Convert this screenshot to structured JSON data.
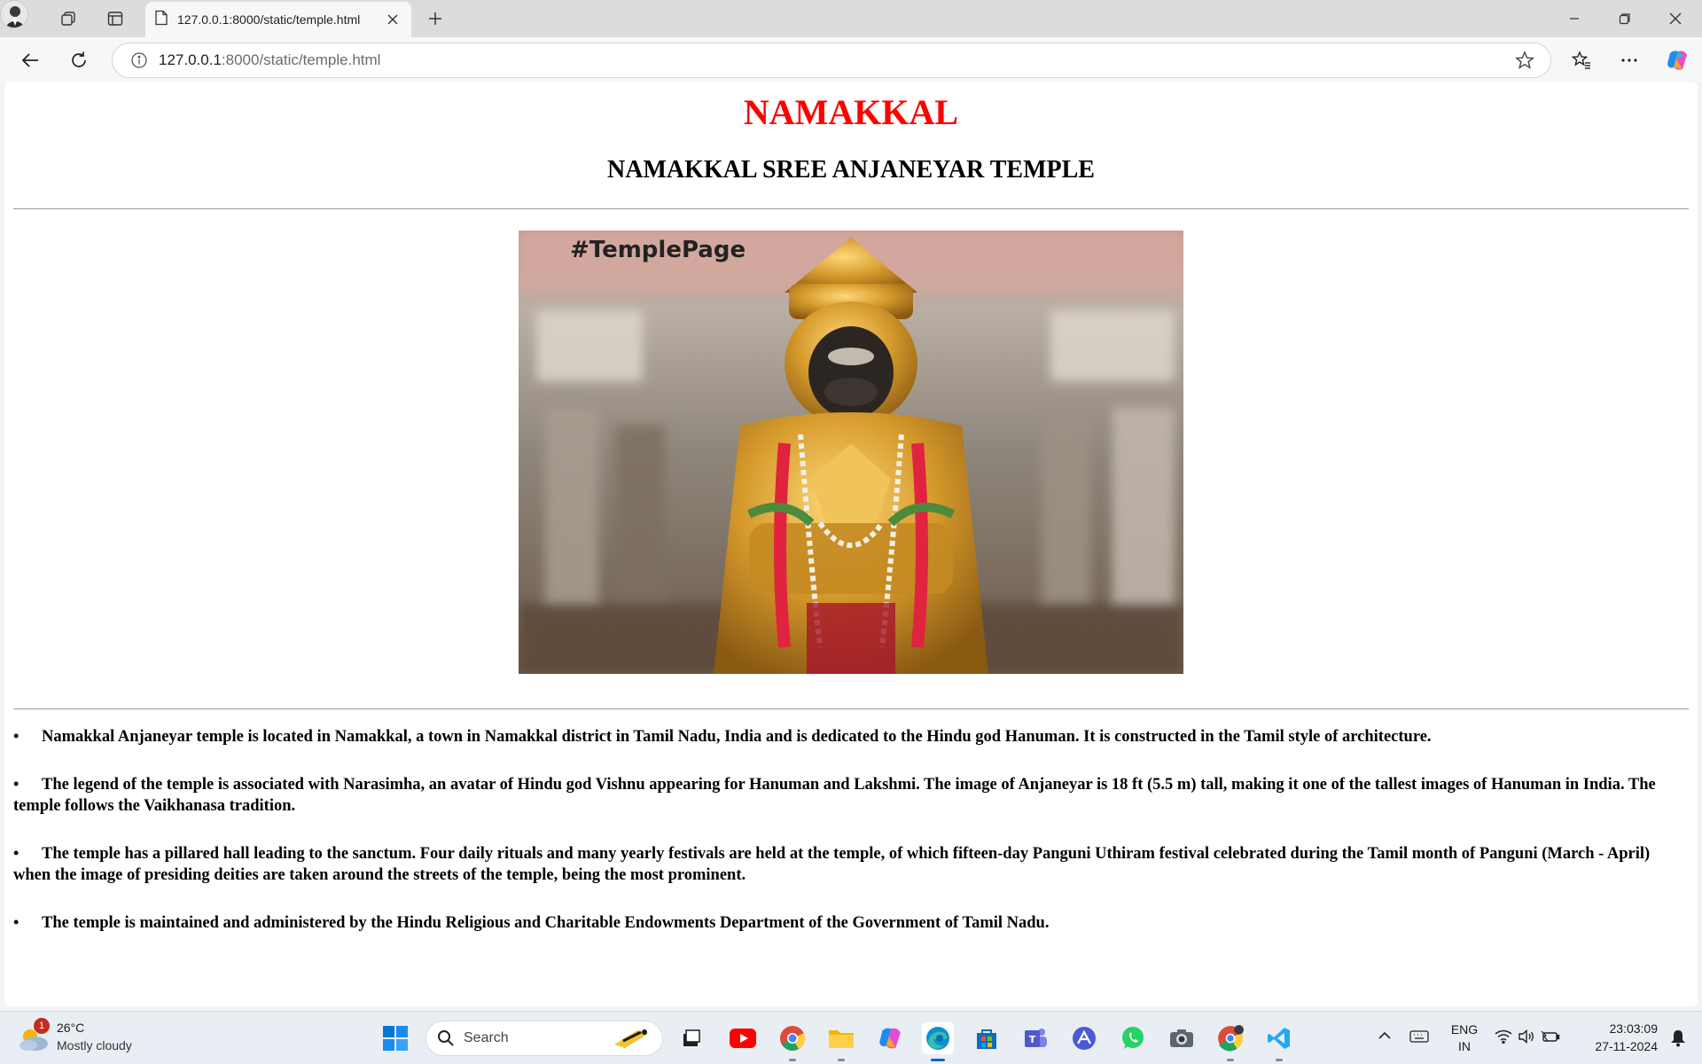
{
  "browser": {
    "tab_title": "127.0.0.1:8000/static/temple.html",
    "url_host": "127.0.0.1",
    "url_rest": ":8000/static/temple.html"
  },
  "page": {
    "site_title": "NAMAKKAL",
    "temple_heading": "NAMAKKAL SREE ANJANEYAR TEMPLE",
    "image_caption": "#TemplePage",
    "facts": [
      "Namakkal Anjaneyar temple is located in Namakkal, a town in Namakkal district in Tamil Nadu, India and is dedicated to the Hindu god Hanuman. It is constructed in the Tamil style of architecture.",
      "The legend of the temple is associated with Narasimha, an avatar of Hindu god Vishnu appearing for Hanuman and Lakshmi. The image of Anjaneyar is 18 ft (5.5 m) tall, making it one of the tallest images of Hanuman in India. The temple follows the Vaikhanasa tradition.",
      "The temple has a pillared hall leading to the sanctum. Four daily rituals and many yearly festivals are held at the temple, of which fifteen-day Panguni Uthiram festival celebrated during the Tamil month of Panguni (March - April) when the image of presiding deities are taken around the streets of the temple, being the most prominent.",
      "The temple is maintained and administered by the Hindu Religious and Charitable Endowments Department of the Government of Tamil Nadu."
    ],
    "bullet": "•"
  },
  "taskbar": {
    "weather_temp": "26°C",
    "weather_desc": "Mostly cloudy",
    "weather_badge": "1",
    "search_label": "Search",
    "lang_top": "ENG",
    "lang_bottom": "IN",
    "time": "23:03:09",
    "date": "27-11-2024"
  },
  "colors": {
    "site_title": "#ff0000",
    "taskbar_accent": "#0067c0"
  }
}
